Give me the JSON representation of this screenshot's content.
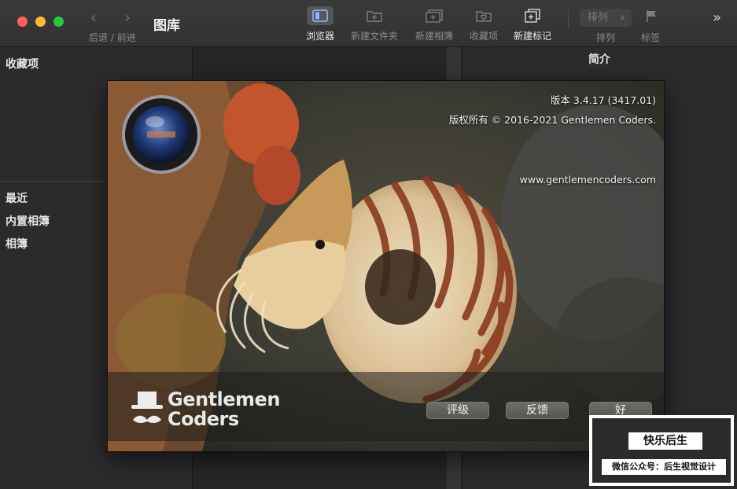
{
  "toolbar": {
    "title": "图库",
    "nav_label": "后退 / 前进",
    "buttons": {
      "browser": "浏览器",
      "new_folder": "新建文件夹",
      "new_album": "新建相簿",
      "favorites": "收藏项",
      "new_mark": "新建标记"
    },
    "sort_value": "排列",
    "sort_label": "排列",
    "tag_label": "标签",
    "more": "»"
  },
  "sidebar": {
    "favorites_header": "收藏项",
    "items": [
      "最近",
      "内置相簿",
      "相簿"
    ]
  },
  "info_panel": {
    "title": "简介"
  },
  "about": {
    "version": "版本 3.4.17 (3417.01)",
    "copyright": "版权所有 © 2016-2021 Gentlemen Coders.",
    "website": "www.gentlemencoders.com",
    "brand_line1": "Gentlemen",
    "brand_line2": "Coders",
    "buttons": {
      "rate": "评级",
      "feedback": "反馈",
      "ok": "好"
    }
  },
  "watermark": {
    "line1": "快乐后生",
    "line2": "微信公众号：后生视觉设计"
  },
  "colors": {
    "close": "#fe5f57",
    "minimize": "#febc2e",
    "zoom": "#28c840",
    "window_bg": "#2b2b2d"
  },
  "icons": [
    "chevron-left-icon",
    "chevron-right-icon",
    "browser-icon",
    "new-folder-icon",
    "new-album-icon",
    "favorites-icon",
    "new-mark-icon",
    "flag-icon",
    "overflow-chevrons-icon"
  ]
}
